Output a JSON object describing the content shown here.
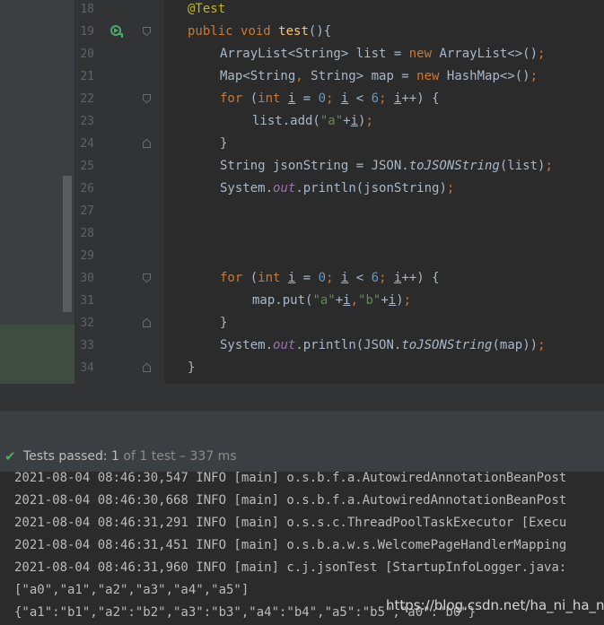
{
  "editor": {
    "lines": [
      {
        "num": "18",
        "segments": [
          {
            "t": "@Test",
            "c": "an"
          }
        ]
      },
      {
        "num": "19",
        "segments": [
          {
            "t": "public",
            "c": "kw"
          },
          {
            "t": " "
          },
          {
            "t": "void",
            "c": "kw"
          },
          {
            "t": " "
          },
          {
            "t": "test",
            "c": "fn"
          },
          {
            "t": "(){"
          }
        ]
      },
      {
        "num": "20",
        "segments": [
          {
            "t": "ArrayList<String> list = "
          },
          {
            "t": "new",
            "c": "kw"
          },
          {
            "t": " ArrayList<>()"
          },
          {
            "t": ";",
            "c": "kw"
          }
        ]
      },
      {
        "num": "21",
        "segments": [
          {
            "t": "Map<String"
          },
          {
            "t": ",",
            "c": "kw"
          },
          {
            "t": " String> map = "
          },
          {
            "t": "new",
            "c": "kw"
          },
          {
            "t": " HashMap<>()"
          },
          {
            "t": ";",
            "c": "kw"
          }
        ]
      },
      {
        "num": "22",
        "segments": [
          {
            "t": "for",
            "c": "kw"
          },
          {
            "t": " ("
          },
          {
            "t": "int",
            "c": "kw"
          },
          {
            "t": " "
          },
          {
            "t": "i",
            "c": "ul"
          },
          {
            "t": " = "
          },
          {
            "t": "0",
            "c": "num"
          },
          {
            "t": "; ",
            "c": "kw"
          },
          {
            "t": "i",
            "c": "ul"
          },
          {
            "t": " < "
          },
          {
            "t": "6",
            "c": "num"
          },
          {
            "t": "; ",
            "c": "kw"
          },
          {
            "t": "i",
            "c": "ul"
          },
          {
            "t": "++) {"
          }
        ]
      },
      {
        "num": "23",
        "segments": [
          {
            "t": "list.add("
          },
          {
            "t": "\"a\"",
            "c": "str"
          },
          {
            "t": "+"
          },
          {
            "t": "i",
            "c": "ul"
          },
          {
            "t": ")"
          },
          {
            "t": ";",
            "c": "kw"
          }
        ]
      },
      {
        "num": "24",
        "segments": [
          {
            "t": "}"
          }
        ]
      },
      {
        "num": "25",
        "segments": [
          {
            "t": "String jsonString = JSON."
          },
          {
            "t": "toJSONString",
            "c": "ital"
          },
          {
            "t": "(list)"
          },
          {
            "t": ";",
            "c": "kw"
          }
        ]
      },
      {
        "num": "26",
        "segments": [
          {
            "t": "System."
          },
          {
            "t": "out",
            "c": "fld"
          },
          {
            "t": ".println(jsonString)"
          },
          {
            "t": ";",
            "c": "kw"
          }
        ]
      },
      {
        "num": "27",
        "segments": []
      },
      {
        "num": "28",
        "segments": []
      },
      {
        "num": "29",
        "segments": []
      },
      {
        "num": "30",
        "segments": [
          {
            "t": "for",
            "c": "kw"
          },
          {
            "t": " ("
          },
          {
            "t": "int",
            "c": "kw"
          },
          {
            "t": " "
          },
          {
            "t": "i",
            "c": "ul"
          },
          {
            "t": " = "
          },
          {
            "t": "0",
            "c": "num"
          },
          {
            "t": "; ",
            "c": "kw"
          },
          {
            "t": "i",
            "c": "ul"
          },
          {
            "t": " < "
          },
          {
            "t": "6",
            "c": "num"
          },
          {
            "t": "; ",
            "c": "kw"
          },
          {
            "t": "i",
            "c": "ul"
          },
          {
            "t": "++) {"
          }
        ]
      },
      {
        "num": "31",
        "segments": [
          {
            "t": "map.put("
          },
          {
            "t": "\"a\"",
            "c": "str"
          },
          {
            "t": "+"
          },
          {
            "t": "i",
            "c": "ul"
          },
          {
            "t": ",",
            "c": "kw"
          },
          {
            "t": "\"b\"",
            "c": "str"
          },
          {
            "t": "+"
          },
          {
            "t": "i",
            "c": "ul"
          },
          {
            "t": ")"
          },
          {
            "t": ";",
            "c": "kw"
          }
        ]
      },
      {
        "num": "32",
        "segments": [
          {
            "t": "}"
          }
        ]
      },
      {
        "num": "33",
        "segments": [
          {
            "t": "System."
          },
          {
            "t": "out",
            "c": "fld"
          },
          {
            "t": ".println(JSON."
          },
          {
            "t": "toJSONString",
            "c": "ital"
          },
          {
            "t": "(map))"
          },
          {
            "t": ";",
            "c": "kw"
          }
        ]
      },
      {
        "num": "34",
        "segments": [
          {
            "t": "}"
          }
        ]
      }
    ]
  },
  "test_status": {
    "check_icon": "check-icon",
    "passed_label": "Tests passed: ",
    "passed_count": "1",
    "detail": " of 1 test – 337 ms"
  },
  "console": {
    "lines": [
      "2021-08-04 08:46:30,547 INFO [main] o.s.b.f.a.AutowiredAnnotationBeanPost",
      "2021-08-04 08:46:30,668 INFO [main] o.s.b.f.a.AutowiredAnnotationBeanPost",
      "2021-08-04 08:46:31,291 INFO [main] o.s.s.c.ThreadPoolTaskExecutor [Execu",
      "2021-08-04 08:46:31,451 INFO [main] o.s.b.a.w.s.WelcomePageHandlerMapping",
      "2021-08-04 08:46:31,960 INFO [main] c.j.jsonTest [StartupInfoLogger.java:",
      "[\"a0\",\"a1\",\"a2\",\"a3\",\"a4\",\"a5\"]",
      "{\"a1\":\"b1\",\"a2\":\"b2\",\"a3\":\"b3\",\"a4\":\"b4\",\"a5\":\"b5\",\"a0\":\"b0\"}"
    ]
  },
  "watermark": "https://blog.csdn.net/ha_ni_ha_ni",
  "colors": {
    "keyword": "#cc7832",
    "annotation": "#bbb529",
    "method": "#ffc66d",
    "string": "#6a8759",
    "number": "#6897bb",
    "field": "#9876aa",
    "passed": "#4ca866"
  }
}
